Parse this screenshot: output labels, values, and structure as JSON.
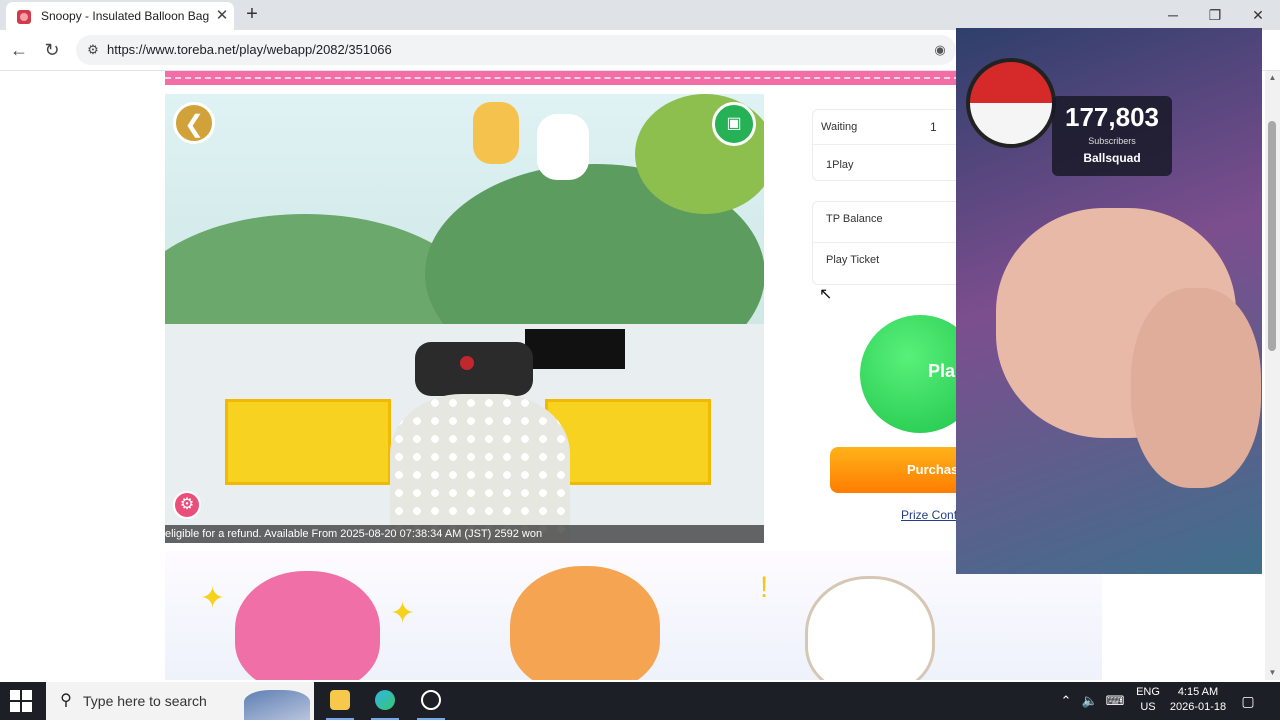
{
  "browser": {
    "tab_title": "Snoopy - Insulated Balloon Bag S",
    "tab_close": "✕",
    "new_tab": "+",
    "url": "https://www.toreba.net/play/webapp/2082/351066",
    "window_controls": [
      "─",
      "❐",
      "✕"
    ]
  },
  "game": {
    "notice": "eligible for a refund. Available From 2025-08-20 07:38:34 AM (JST) 2592 won"
  },
  "panel": {
    "waiting_label": "Waiting",
    "waiting_value": "1",
    "oneplay_label": "1Play",
    "tp_balance_label": "TP Balance",
    "play_ticket_label": "Play Ticket",
    "play_button": "Pla",
    "purchase_button": "Purchas",
    "prize_link": "Prize Confi"
  },
  "overlay": {
    "subscriber_count": "177,803",
    "subscriber_label": "Subscribers",
    "channel_name": "Ballsquad"
  },
  "taskbar": {
    "search_placeholder": "Type here to search",
    "lang_top": "ENG",
    "lang_bottom": "US",
    "time": "4:15 AM",
    "date": "2026-01-18"
  },
  "colors": {
    "accent_pink": "#f36ea6",
    "play_green": "#1fc44a",
    "purchase_orange": "#ff7d00"
  },
  "icons": {
    "back": "chevron-left-icon",
    "camera": "video-camera-icon",
    "settings": "gear-icon",
    "search": "search-icon"
  }
}
